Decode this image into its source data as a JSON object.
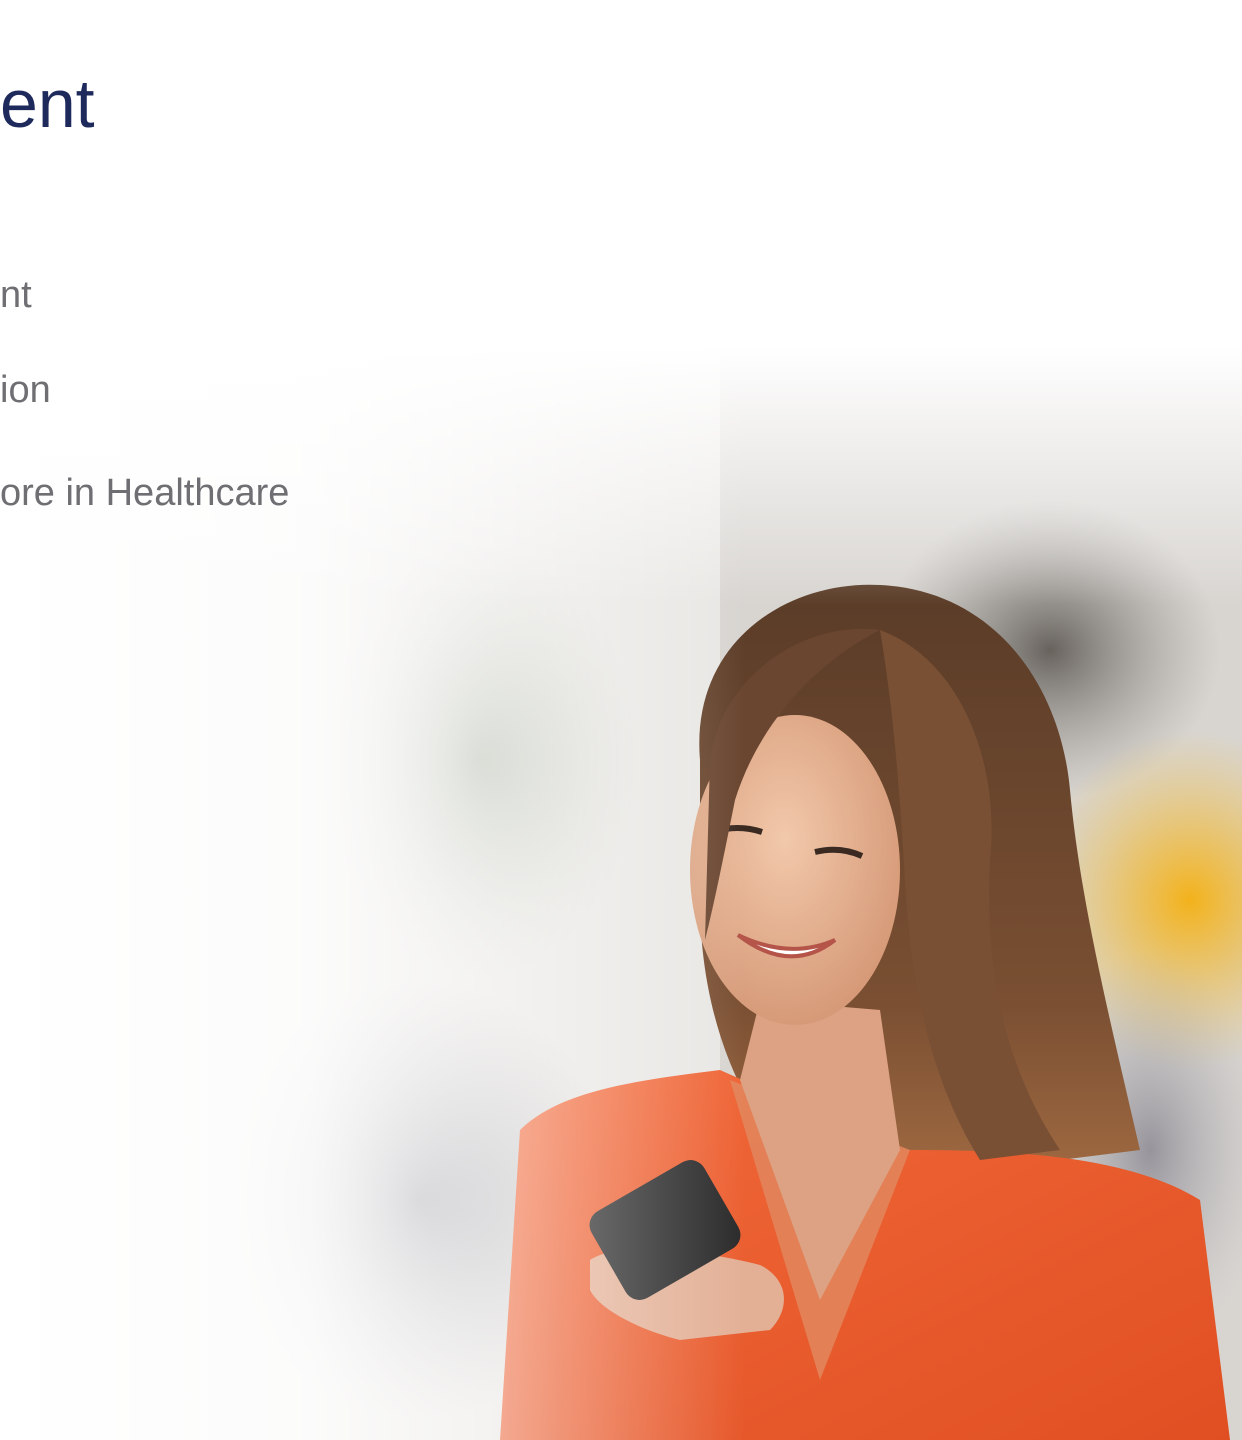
{
  "slide": {
    "title": "ent",
    "bullets": [
      "nt",
      "ion",
      "ore in Healthcare"
    ]
  },
  "image": {
    "description_icon": "woman-with-phone-photo"
  },
  "colors": {
    "title": "#1f2a5c",
    "bullet_text": "#6e6e73",
    "shirt": "#ee5a2c"
  }
}
